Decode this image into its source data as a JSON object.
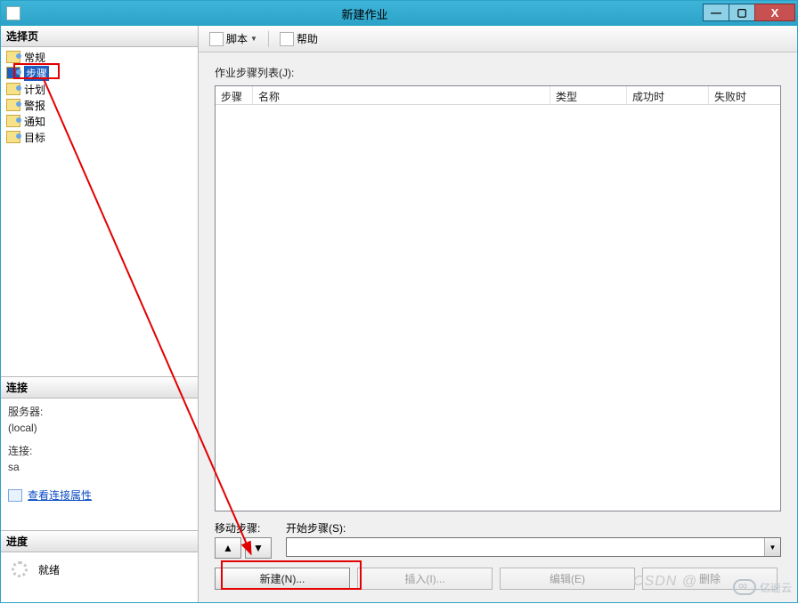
{
  "window": {
    "title": "新建作业"
  },
  "winbuttons": {
    "min": "—",
    "max": "▢",
    "close": "X"
  },
  "left": {
    "select_header": "选择页",
    "nav": [
      {
        "label": "常规"
      },
      {
        "label": "步骤"
      },
      {
        "label": "计划"
      },
      {
        "label": "警报"
      },
      {
        "label": "通知"
      },
      {
        "label": "目标"
      }
    ],
    "conn_header": "连接",
    "server_label": "服务器:",
    "server_value": "(local)",
    "conn_label": "连接:",
    "conn_value": "sa",
    "view_props": "查看连接属性",
    "progress_header": "进度",
    "progress_status": "就绪"
  },
  "toolbar": {
    "script": "脚本",
    "help": "帮助"
  },
  "main": {
    "list_label": "作业步骤列表(J):",
    "columns": {
      "step": "步骤",
      "name": "名称",
      "type": "类型",
      "success": "成功时",
      "fail": "失败时"
    },
    "move_label": "移动步骤:",
    "start_label": "开始步骤(S):",
    "start_value": "",
    "buttons": {
      "new": "新建(N)...",
      "insert": "插入(I)...",
      "edit": "编辑(E)",
      "delete": "删除"
    }
  },
  "watermarks": {
    "csdn": "CSDN @",
    "yisu": "亿速云"
  }
}
